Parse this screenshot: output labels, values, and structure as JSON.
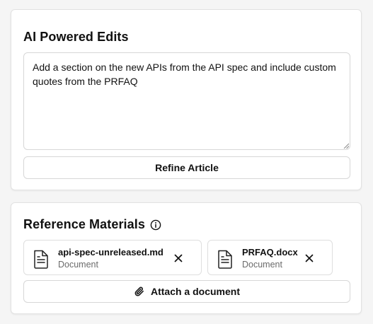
{
  "ai_edits": {
    "title": "AI Powered Edits",
    "prompt_value": "Add a section on the new APIs from the API spec and include custom quotes from the PRFAQ",
    "refine_button_label": "Refine Article"
  },
  "reference_materials": {
    "title": "Reference Materials",
    "info_icon": "info-icon",
    "documents": [
      {
        "name": "api-spec-unreleased.md",
        "type": "Document",
        "icon": "file-text-icon"
      },
      {
        "name": "PRFAQ.docx",
        "type": "Document",
        "icon": "file-text-icon"
      }
    ],
    "attach_button_label": "Attach a document",
    "attach_icon": "paperclip-icon"
  },
  "colors": {
    "background": "#f5f5f5",
    "card": "#ffffff",
    "border": "#e2e2e2",
    "text": "#111111",
    "muted_text": "#6b6b6b"
  }
}
